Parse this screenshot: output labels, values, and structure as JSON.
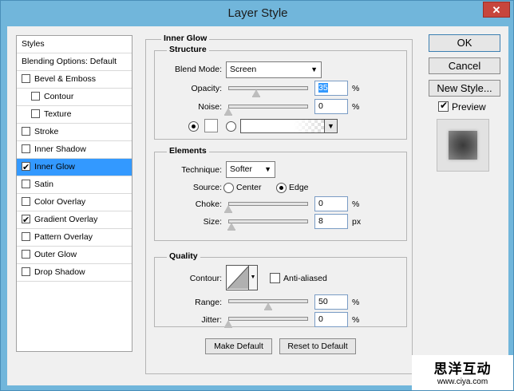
{
  "window": {
    "title": "Layer Style",
    "close_glyph": "✕"
  },
  "style_list": {
    "header": "Styles",
    "blending": "Blending Options: Default",
    "items": [
      {
        "label": "Bevel & Emboss",
        "checked": false
      },
      {
        "label": "Contour",
        "checked": false
      },
      {
        "label": "Texture",
        "checked": false
      },
      {
        "label": "Stroke",
        "checked": false
      },
      {
        "label": "Inner Shadow",
        "checked": false
      },
      {
        "label": "Inner Glow",
        "checked": true,
        "selected": true
      },
      {
        "label": "Satin",
        "checked": false
      },
      {
        "label": "Color Overlay",
        "checked": false
      },
      {
        "label": "Gradient Overlay",
        "checked": true
      },
      {
        "label": "Pattern Overlay",
        "checked": false
      },
      {
        "label": "Outer Glow",
        "checked": false
      },
      {
        "label": "Drop Shadow",
        "checked": false
      }
    ]
  },
  "panel": {
    "title": "Inner Glow",
    "structure": {
      "title": "Structure",
      "blend_mode_label": "Blend Mode:",
      "blend_mode_value": "Screen",
      "opacity_label": "Opacity:",
      "opacity_value": "35",
      "opacity_pct": 0.35,
      "noise_label": "Noise:",
      "noise_value": "0",
      "noise_pct": 0,
      "unit_pct": "%"
    },
    "elements": {
      "title": "Elements",
      "technique_label": "Technique:",
      "technique_value": "Softer",
      "source_label": "Source:",
      "source_center": "Center",
      "source_edge": "Edge",
      "choke_label": "Choke:",
      "choke_value": "0",
      "choke_pct": 0,
      "size_label": "Size:",
      "size_value": "8",
      "size_pct": 0.04,
      "unit_px": "px"
    },
    "quality": {
      "title": "Quality",
      "contour_label": "Contour:",
      "antialiased_label": "Anti-aliased",
      "range_label": "Range:",
      "range_value": "50",
      "range_pct": 0.5,
      "jitter_label": "Jitter:",
      "jitter_value": "0",
      "jitter_pct": 0
    },
    "make_default": "Make Default",
    "reset_default": "Reset to Default"
  },
  "actions": {
    "ok": "OK",
    "cancel": "Cancel",
    "new_style": "New Style...",
    "preview_label": "Preview"
  },
  "watermark": {
    "line1": "思洋互动",
    "line2": "www.ciya.com"
  }
}
